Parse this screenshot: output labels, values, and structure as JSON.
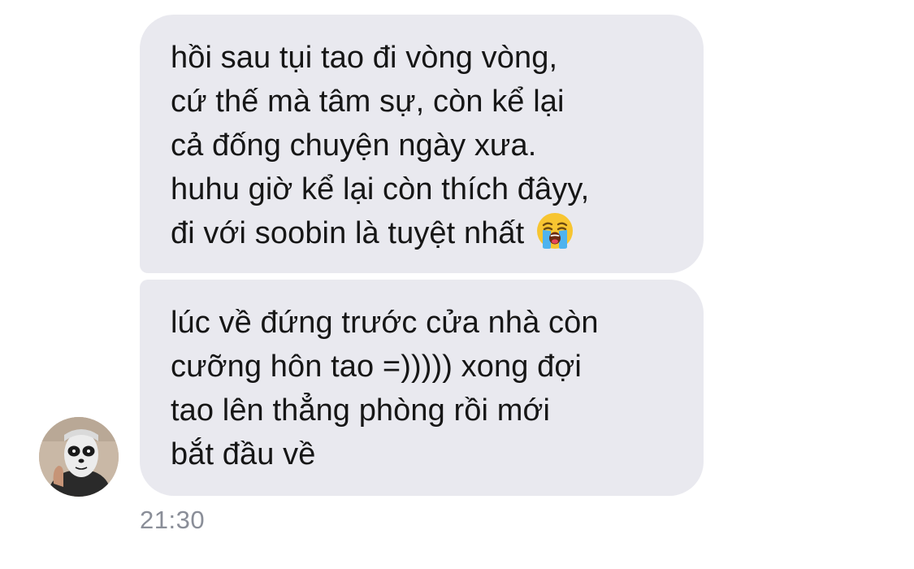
{
  "messages": [
    {
      "lines": [
        "hồi sau tụi tao đi vòng vòng,",
        "cứ thế mà tâm sự, còn kể lại",
        "cả đống chuyện ngày xưa.",
        "huhu giờ kể lại còn thích đâyy,",
        "đi với soobin là tuyệt nhất"
      ],
      "emoji": "loudly-crying-face"
    },
    {
      "lines": [
        "lúc về đứng trước cửa nhà còn",
        "cưỡng hôn tao =))))) xong đợi",
        "tao lên thẳng phòng rồi mới",
        "bắt đầu về"
      ]
    }
  ],
  "timestamp": "21:30",
  "colors": {
    "bubble": "#e9e9ef",
    "text": "#161616",
    "timestamp": "#8a8e98"
  }
}
